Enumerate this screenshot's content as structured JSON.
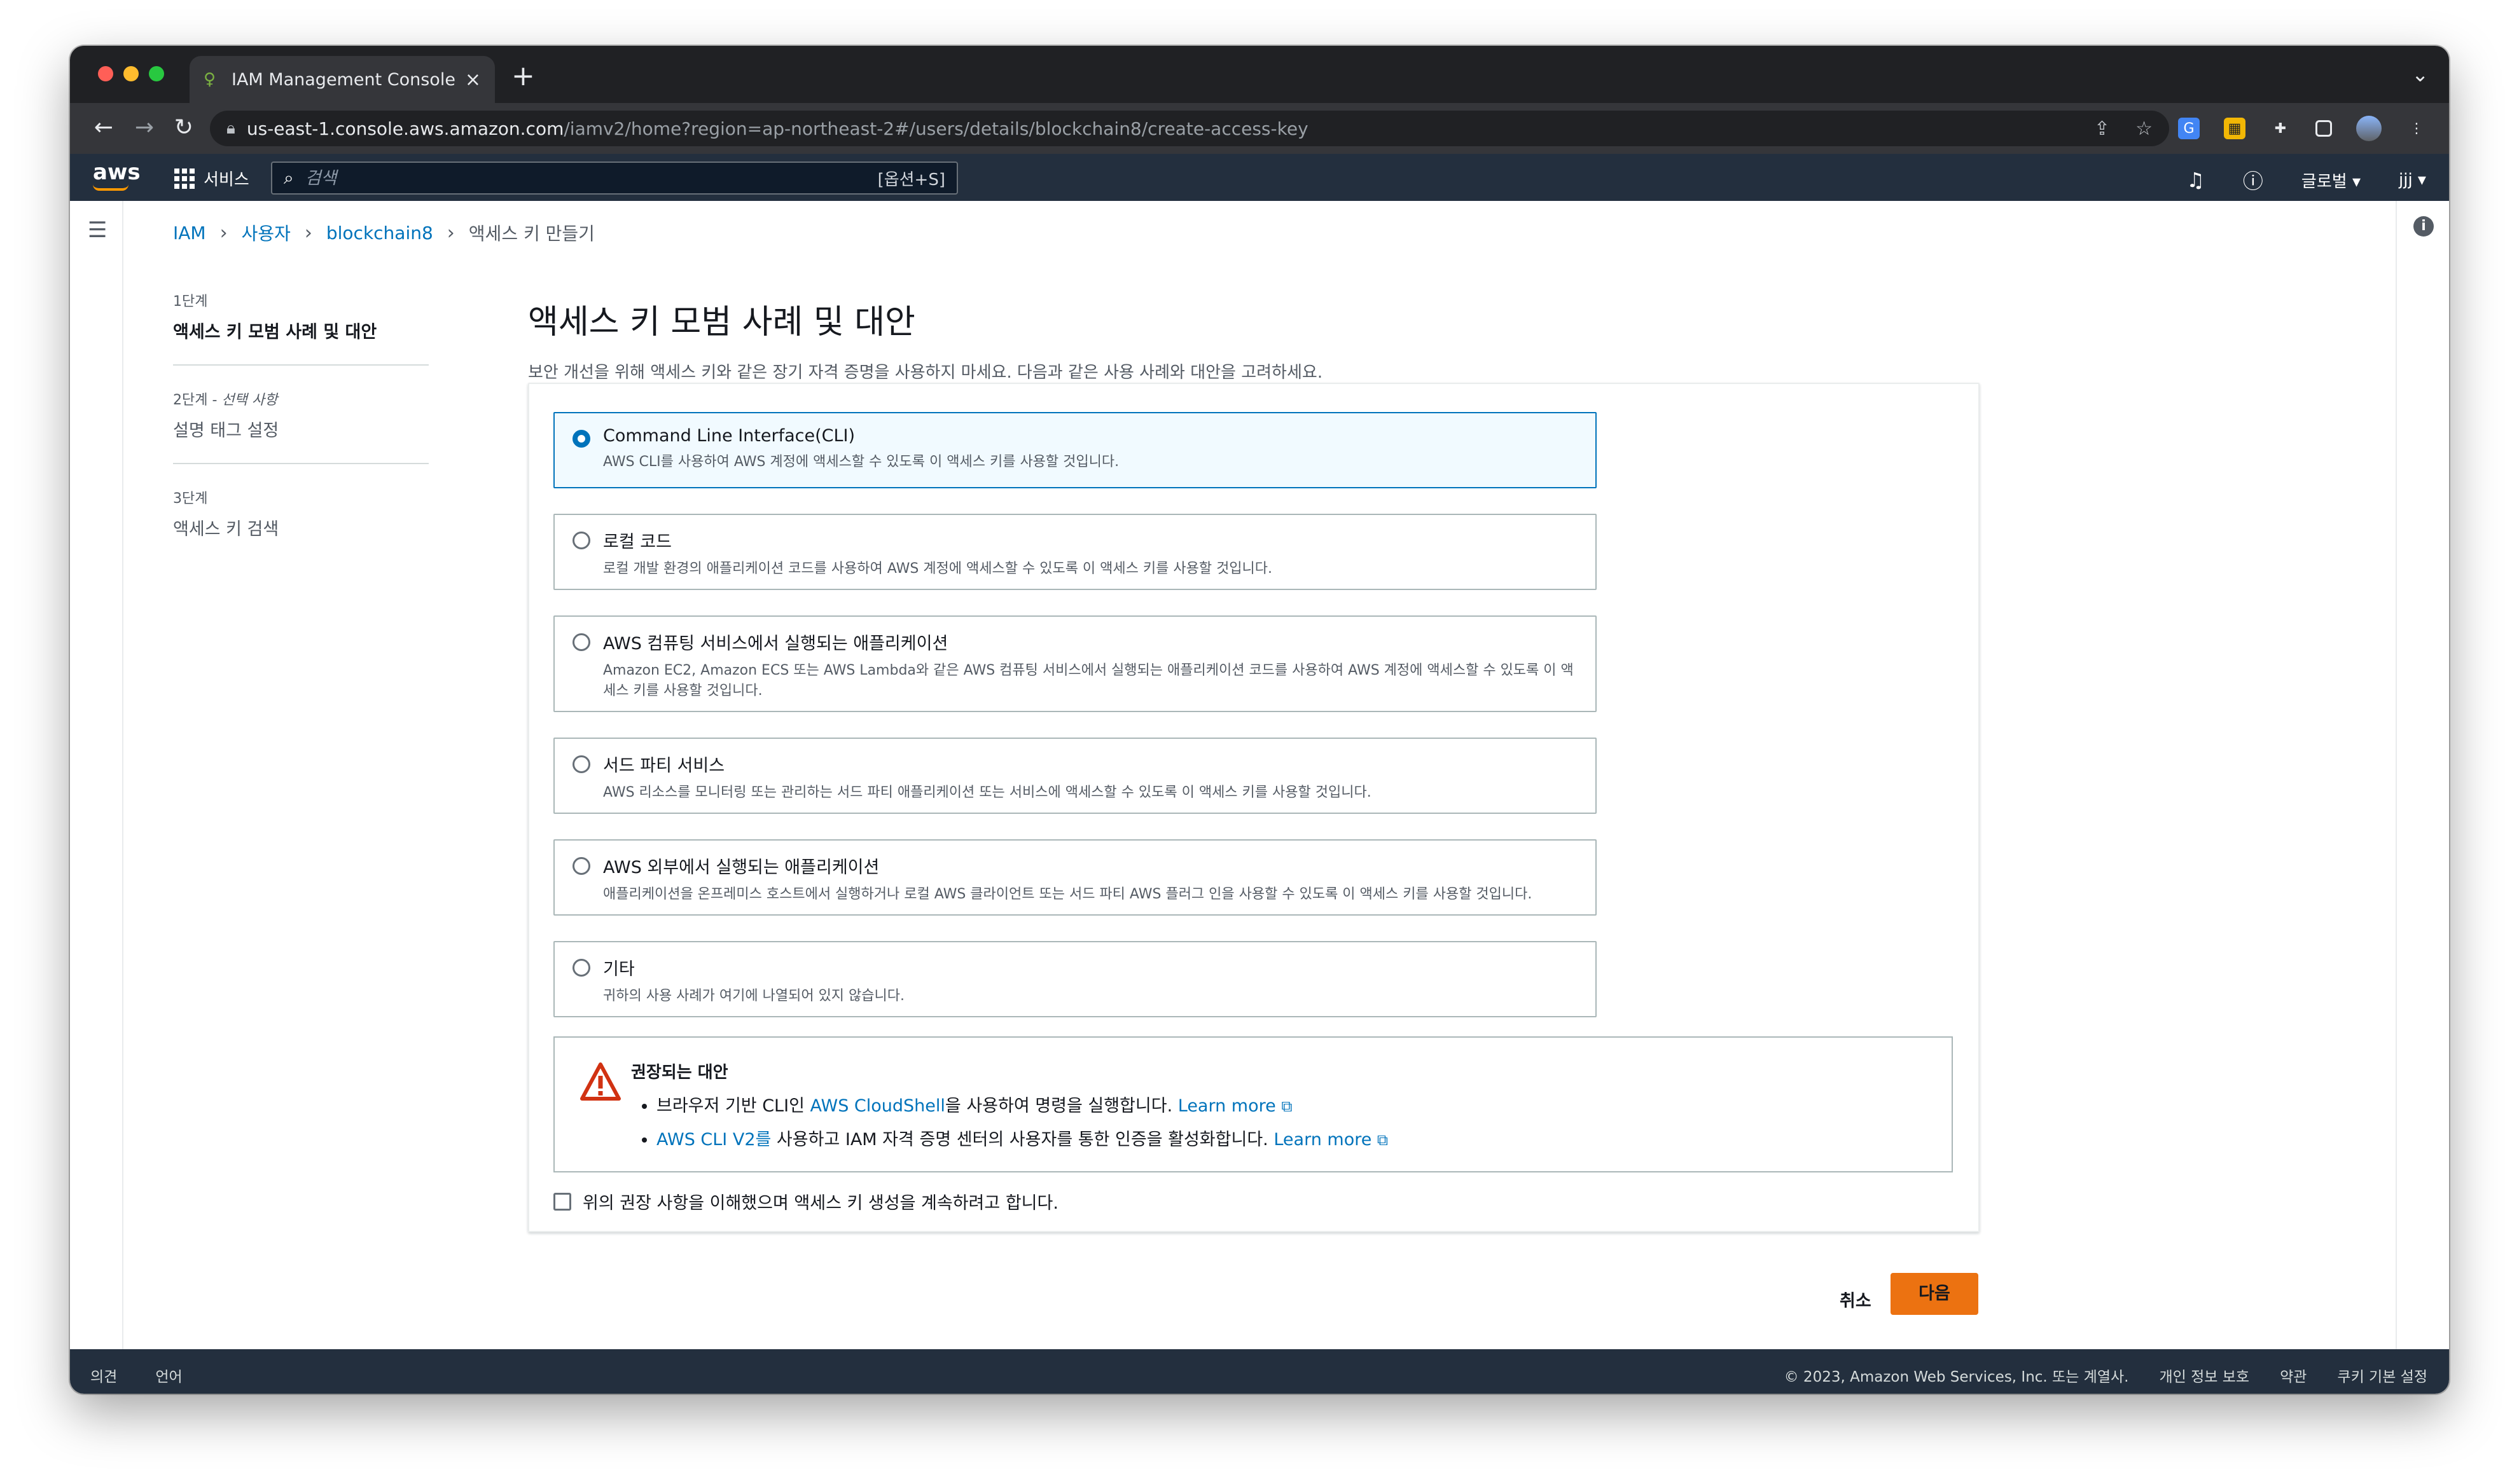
{
  "browser": {
    "tab_title": "IAM Management Console",
    "url_host": "us-east-1.console.aws.amazon.com",
    "url_path": "/iamv2/home?region=ap-northeast-2#/users/details/blockchain8/create-access-key"
  },
  "aws_nav": {
    "logo": "aws",
    "services_label": "서비스",
    "search_placeholder": "검색",
    "search_shortcut": "[옵션+S]",
    "region_label": "글로벌 ▾",
    "user_label": "jjj ▾"
  },
  "breadcrumb": {
    "items": [
      "IAM",
      "사용자",
      "blockchain8"
    ],
    "current": "액세스 키 만들기"
  },
  "steps": [
    {
      "number": "1단계",
      "optional": "",
      "title": "액세스 키 모범 사례 및 대안"
    },
    {
      "number": "2단계 - ",
      "optional": "선택 사항",
      "title": "설명 태그 설정"
    },
    {
      "number": "3단계",
      "optional": "",
      "title": "액세스 키 검색"
    }
  ],
  "main": {
    "title": "액세스 키 모범 사례 및 대안",
    "description": "보안 개선을 위해 액세스 키와 같은 장기 자격 증명을 사용하지 마세요. 다음과 같은 사용 사례와 대안을 고려하세요."
  },
  "options": [
    {
      "title": "Command Line Interface(CLI)",
      "desc": "AWS CLI를 사용하여 AWS 계정에 액세스할 수 있도록 이 액세스 키를 사용할 것입니다.",
      "selected": true
    },
    {
      "title": "로컬 코드",
      "desc": "로컬 개발 환경의 애플리케이션 코드를 사용하여 AWS 계정에 액세스할 수 있도록 이 액세스 키를 사용할 것입니다.",
      "selected": false
    },
    {
      "title": "AWS 컴퓨팅 서비스에서 실행되는 애플리케이션",
      "desc": "Amazon EC2, Amazon ECS 또는 AWS Lambda와 같은 AWS 컴퓨팅 서비스에서 실행되는 애플리케이션 코드를 사용하여 AWS 계정에 액세스할 수 있도록 이 액세스 키를 사용할 것입니다.",
      "selected": false
    },
    {
      "title": "서드 파티 서비스",
      "desc": "AWS 리소스를 모니터링 또는 관리하는 서드 파티 애플리케이션 또는 서비스에 액세스할 수 있도록 이 액세스 키를 사용할 것입니다.",
      "selected": false
    },
    {
      "title": "AWS 외부에서 실행되는 애플리케이션",
      "desc": "애플리케이션을 온프레미스 호스트에서 실행하거나 로컬 AWS 클라이언트 또는 서드 파티 AWS 플러그 인을 사용할 수 있도록 이 액세스 키를 사용할 것입니다.",
      "selected": false
    },
    {
      "title": "기타",
      "desc": "귀하의 사용 사례가 여기에 나열되어 있지 않습니다.",
      "selected": false
    }
  ],
  "alert": {
    "title": "권장되는 대안",
    "item1_prefix": "브라우저 기반 CLI인 ",
    "item1_link": "AWS CloudShell",
    "item1_suffix": "을 사용하여 명령을 실행합니다.",
    "item2_link": "AWS CLI V2를",
    "item2_suffix": " 사용하고 IAM 자격 증명 센터의 사용자를 통한 인증을 활성화합니다.",
    "learn_more": "Learn more"
  },
  "acknowledge_label": "위의 권장 사항을 이해했으며 액세스 키 생성을 계속하려고 합니다.",
  "actions": {
    "cancel": "취소",
    "next": "다음"
  },
  "footer": {
    "feedback": "의견",
    "language": "언어",
    "copyright": "© 2023, Amazon Web Services, Inc. 또는 계열사.",
    "privacy": "개인 정보 보호",
    "terms": "약관",
    "cookies": "쿠키 기본 설정"
  },
  "colors": {
    "aws_nav": "#232f3e",
    "link": "#0073bb",
    "primary_button": "#ec7211",
    "selected_bg": "#f1faff",
    "warning": "#d13212"
  }
}
